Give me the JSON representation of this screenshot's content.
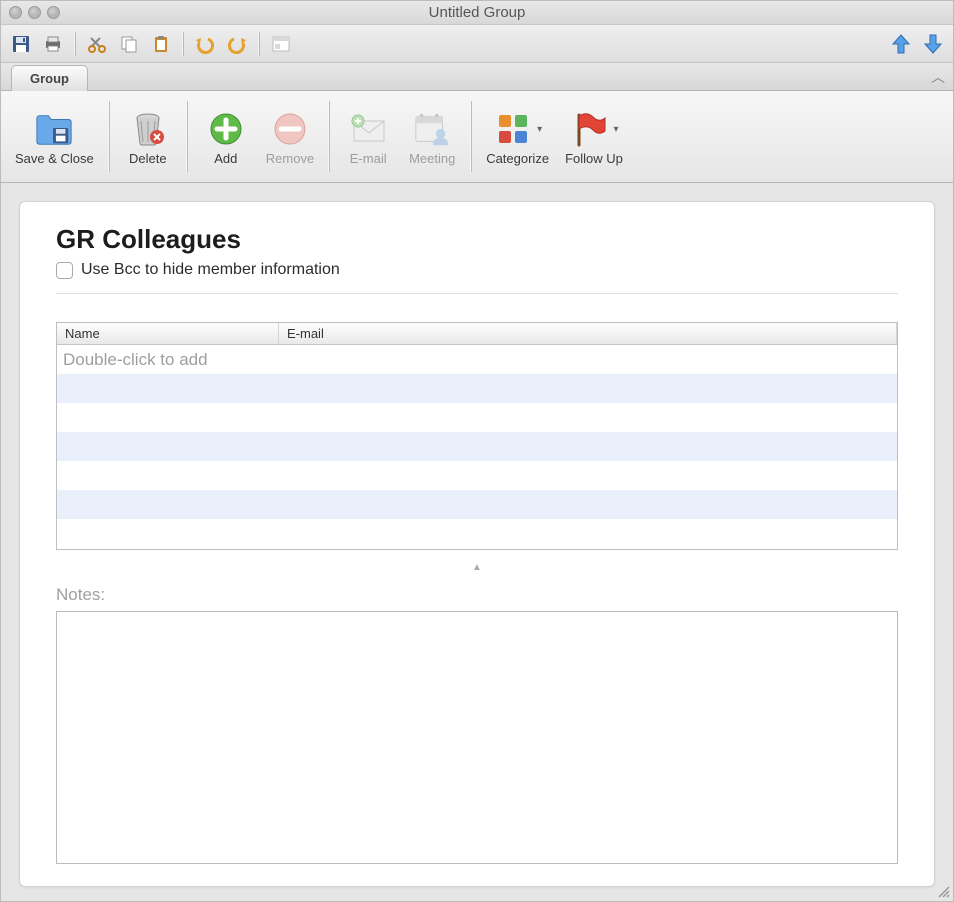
{
  "window": {
    "title": "Untitled Group"
  },
  "quick_toolbar": {
    "save": "save-icon",
    "print": "print-icon",
    "cut": "cut-icon",
    "copy": "copy-icon",
    "paste": "paste-icon",
    "undo": "undo-icon",
    "redo": "redo-icon",
    "form": "form-icon",
    "prev": "up-arrow-icon",
    "next": "down-arrow-icon"
  },
  "tab": {
    "label": "Group"
  },
  "ribbon": {
    "save_close": "Save & Close",
    "delete": "Delete",
    "add": "Add",
    "remove": "Remove",
    "email": "E-mail",
    "meeting": "Meeting",
    "categorize": "Categorize",
    "follow_up": "Follow Up"
  },
  "content": {
    "group_name": "GR Colleagues",
    "bcc_label": "Use Bcc to hide member information",
    "bcc_checked": false,
    "table": {
      "col_name": "Name",
      "col_email": "E-mail",
      "placeholder": "Double-click to add",
      "rows": []
    },
    "notes_label": "Notes:",
    "notes_value": ""
  }
}
